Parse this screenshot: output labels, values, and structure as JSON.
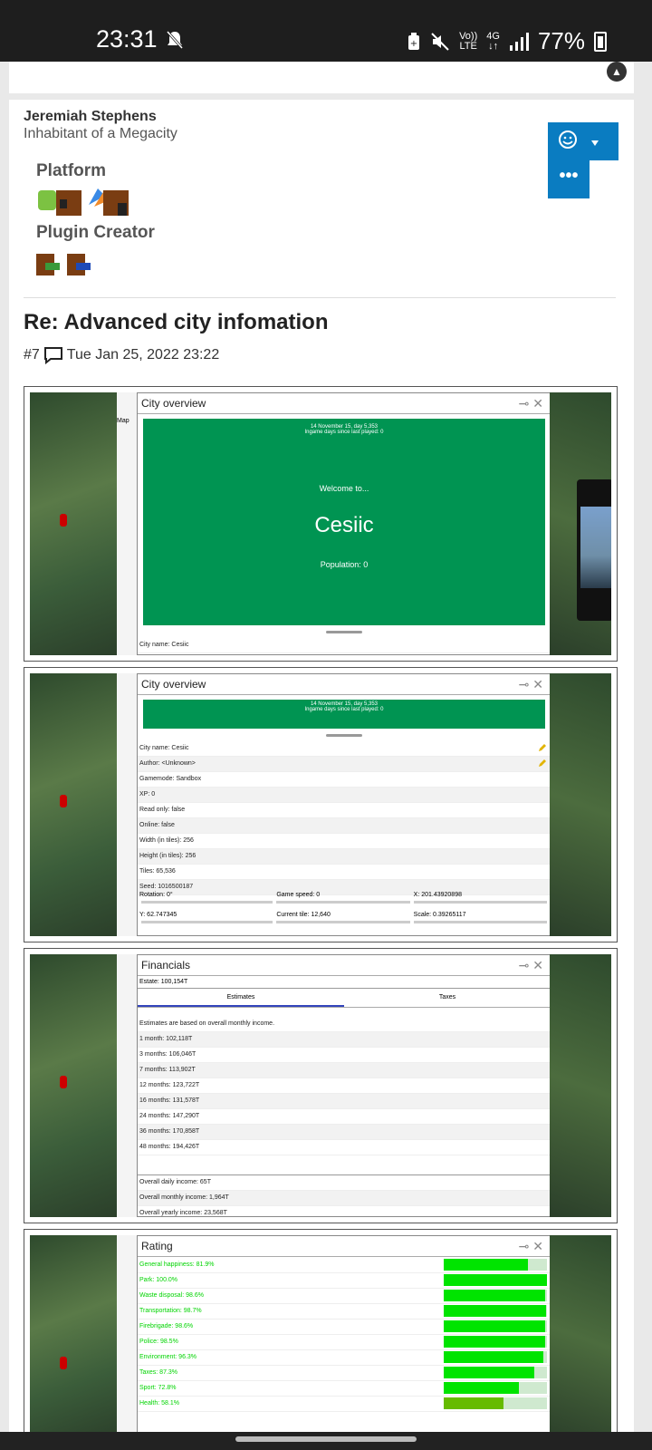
{
  "status": {
    "time": "23:31",
    "battery": "77%",
    "net_top": "Vo))",
    "net_bottom": "LTE",
    "sig_top": "4G",
    "sig_bottom": "↓↑"
  },
  "post": {
    "author": "Jeremiah Stephens",
    "rank": "Inhabitant of a Megacity",
    "group1": "Platform",
    "group2": "Plugin Creator",
    "title": "Re: Advanced city infomation",
    "post_num": "#7",
    "date": "Tue Jan 25, 2022 23:22",
    "more": "•••"
  },
  "shot1": {
    "win_title": "City overview",
    "date_line": "14 November 15, day 5,353",
    "days_line": "Ingame days since last played: 0",
    "welcome": "Welcome to...",
    "city": "Cesiic",
    "population": "Population: 0",
    "city_name": "City name: Cesiic"
  },
  "shot2": {
    "win_title": "City overview",
    "date_line": "14 November 15, day 5,353",
    "days_line": "Ingame days since last played: 0",
    "rows": [
      "City name: Cesiic",
      "Author: <Unknown>",
      "Gamemode: Sandbox",
      "XP: 0",
      "Read only: false",
      "Online: false",
      "Width (in tiles): 256",
      "Height (in tiles): 256",
      "Tiles: 65,536",
      "Seed: 1016500187"
    ],
    "rotation": "Rotation: 0°",
    "speed": "Game speed: 0",
    "x": "X: 201.43920898",
    "y": "Y: 62.747345",
    "tile": "Current tile: 12,640",
    "scale": "Scale: 0.39265117"
  },
  "shot3": {
    "win_title": "Financials",
    "estate": "Estate: 100,154T",
    "tab1": "Estimates",
    "tab2": "Taxes",
    "desc": "Estimates are based on overall monthly income.",
    "rows": [
      "1 month: 102,118T",
      "3 months: 106,046T",
      "7 months: 113,902T",
      "12 months: 123,722T",
      "16 months: 131,578T",
      "24 months: 147,290T",
      "36 months: 170,858T",
      "48 months: 194,426T"
    ],
    "daily": "Overall daily income: 65T",
    "monthly": "Overall monthly income: 1,964T",
    "yearly": "Overall yearly income: 23,568T"
  },
  "shot4": {
    "win_title": "Rating",
    "rows": [
      {
        "label": "General happiness: 81.9%",
        "value": 81.9
      },
      {
        "label": "Park: 100.0%",
        "value": 100
      },
      {
        "label": "Waste disposal: 98.6%",
        "value": 98.6
      },
      {
        "label": "Transportation: 98.7%",
        "value": 98.7
      },
      {
        "label": "Firebrigade: 98.6%",
        "value": 98.6
      },
      {
        "label": "Police: 98.5%",
        "value": 98.5
      },
      {
        "label": "Environment: 96.3%",
        "value": 96.3
      },
      {
        "label": "Taxes: 87.3%",
        "value": 87.3
      },
      {
        "label": "Sport: 72.8%",
        "value": 72.8
      },
      {
        "label": "Health: 58.1%",
        "value": 58.1
      }
    ]
  },
  "toolbar_label": "Map",
  "colors": {
    "accent": "#0a7cc1",
    "window_green": "#009452",
    "bar_green": "#00e400"
  }
}
